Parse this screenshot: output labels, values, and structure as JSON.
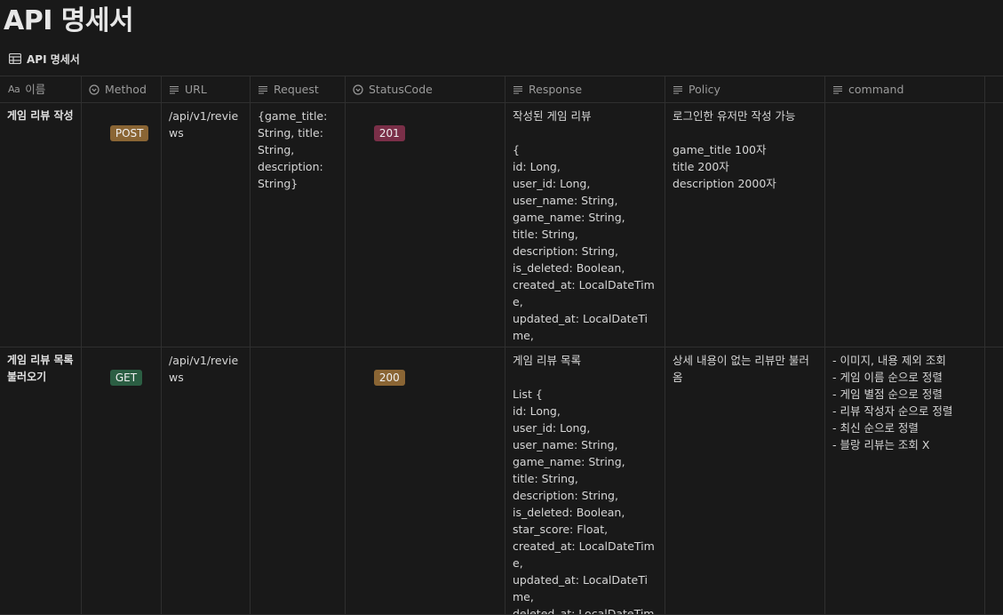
{
  "page": {
    "title": "API 명세서"
  },
  "view": {
    "label": "API 명세서",
    "icon": "table-icon"
  },
  "columns": [
    {
      "label": "이름",
      "icon": "text-aa-icon"
    },
    {
      "label": "Method",
      "icon": "select-icon"
    },
    {
      "label": "URL",
      "icon": "lines-icon"
    },
    {
      "label": "Request",
      "icon": "lines-icon"
    },
    {
      "label": "StatusCode",
      "icon": "select-icon"
    },
    {
      "label": "Response",
      "icon": "lines-icon"
    },
    {
      "label": "Policy",
      "icon": "lines-icon"
    },
    {
      "label": "command",
      "icon": "lines-icon"
    }
  ],
  "title_prefix": "Aa",
  "rows": [
    {
      "name": "게임 리뷰 작성",
      "method": "POST",
      "url": "/api/v1/reviews",
      "request": "{game_title: String, title: String, description: String}",
      "status": "201",
      "response": "작성된 게임 리뷰\n\n{\nid: Long,\nuser_id: Long,\nuser_name: String,\ngame_name: String,\ntitle: String,\ndescription: String,\nis_deleted: Boolean,\ncreated_at: LocalDateTime,\nupdated_at: LocalDateTime,\ndeleted_at: LocalDateTime\n}",
      "policy": "로그인한 유저만 작성 가능\n\ngame_title 100자\ntitle 200자\ndescription 2000자",
      "command": ""
    },
    {
      "name": "게임 리뷰 목록 불러오기",
      "method": "GET",
      "url": "/api/v1/reviews",
      "request": "",
      "status": "200",
      "response": "게임 리뷰 목록\n\nList {\nid: Long,\nuser_id: Long,\nuser_name: String,\ngame_name: String,\ntitle: String,\ndescription: String,\nis_deleted: Boolean,\nstar_score: Float,\ncreated_at: LocalDateTime,\nupdated_at: LocalDateTime,\ndeleted_at: LocalDateTime\n}",
      "policy": "상세 내용이 없는 리뷰만 불러옴",
      "command": "- 이미지, 내용 제외 조회\n- 게임 이름 순으로 정렬\n- 게임 별점 순으로 정렬\n- 리뷰 작성자 순으로 정렬\n- 최신 순으로 정렬\n- 블랑 리뷰는 조회 X"
    }
  ],
  "colors": {
    "background": "#191919",
    "tag_post": "#8a6534",
    "tag_get": "#2b5e43",
    "tag_201": "#7a2f48",
    "tag_200": "#8a6534"
  }
}
